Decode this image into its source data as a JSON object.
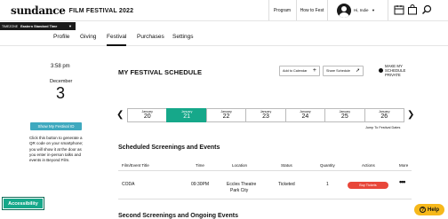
{
  "header": {
    "logo_main": "sundance",
    "logo_sub": "FILM FESTIVAL 2022",
    "nav": [
      "Program",
      "How to Fest"
    ],
    "user_greeting": "Hi, Indie",
    "icons": [
      "avatar",
      "calendar-icon",
      "shopping-bag-icon",
      "search-icon"
    ]
  },
  "timezone": {
    "label": "TIMEZONE",
    "value": "Eastern Standard Time"
  },
  "tabs": [
    {
      "label": "Profile",
      "active": false
    },
    {
      "label": "Giving",
      "active": false
    },
    {
      "label": "Festival",
      "active": true
    },
    {
      "label": "Purchases",
      "active": false
    },
    {
      "label": "Settings",
      "active": false
    }
  ],
  "left": {
    "time": "3:58 pm",
    "month": "December",
    "day": "3",
    "qr_button": "Show My Festival ID",
    "qr_description": "Click this button to generate a QR code on your smartphone; you will show it at the door as you enter in-person talks and events in Beyond Film."
  },
  "schedule": {
    "title": "MY FESTIVAL SCHEDULE",
    "add_calendar": "Add to Calendar",
    "share": "Share Schedule",
    "private_label": "MAKE MY SCHEDULE PRIVATE",
    "jump_label": "Jump To Festival Dates",
    "dates": [
      {
        "month": "January",
        "day": "20",
        "active": false
      },
      {
        "month": "January",
        "day": "21",
        "active": true
      },
      {
        "month": "January",
        "day": "22",
        "active": false
      },
      {
        "month": "January",
        "day": "23",
        "active": false
      },
      {
        "month": "January",
        "day": "24",
        "active": false
      },
      {
        "month": "January",
        "day": "25",
        "active": false
      },
      {
        "month": "January",
        "day": "26",
        "active": false
      }
    ]
  },
  "screenings": {
    "title": "Scheduled Screenings and Events",
    "columns": [
      "Film/Event Title",
      "Time",
      "Location",
      "Status",
      "Quantity",
      "Actions",
      "More"
    ],
    "rows": [
      {
        "title": "CODA",
        "time": "09:30PM",
        "location_line1": "Eccles Theatre",
        "location_line2": "Park City",
        "status": "Ticketed",
        "quantity": "1",
        "action": "Buy Tickets",
        "more": "•••"
      }
    ]
  },
  "next_section_title": "Second Screenings and Ongoing Events",
  "accessibility_label": "Accessibility",
  "help_label": "Help",
  "colors": {
    "accent_teal": "#16a88a",
    "qr_blue": "#3fa9bf",
    "buy_red": "#e8473a",
    "help_yellow": "#f6b81b"
  }
}
